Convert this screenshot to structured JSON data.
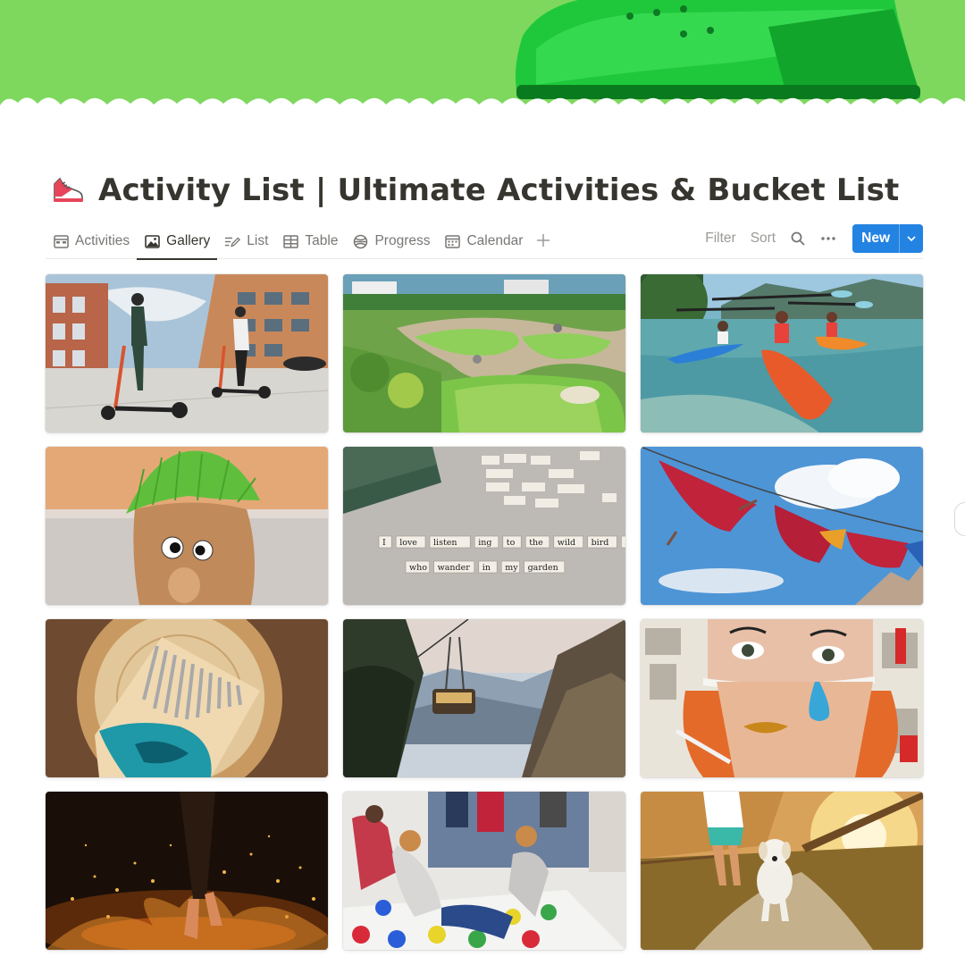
{
  "page": {
    "title": "Activity List | Ultimate Activities & Bucket List",
    "icon": "sneaker-icon"
  },
  "colors": {
    "cover_green": "#7ed85e",
    "accent_blue": "#2383e2",
    "text": "#37352f",
    "muted": "#787774"
  },
  "views": [
    {
      "label": "Activities",
      "icon": "board-icon",
      "active": false
    },
    {
      "label": "Gallery",
      "icon": "image-icon",
      "active": true
    },
    {
      "label": "List",
      "icon": "list-edit-icon",
      "active": false
    },
    {
      "label": "Table",
      "icon": "table-icon",
      "active": false
    },
    {
      "label": "Progress",
      "icon": "progress-icon",
      "active": false
    },
    {
      "label": "Calendar",
      "icon": "calendar-icon",
      "active": false
    }
  ],
  "toolbar": {
    "filter_label": "Filter",
    "sort_label": "Sort",
    "new_label": "New"
  },
  "gallery": {
    "cards": [
      {
        "image": "electric-scooters-city-photo"
      },
      {
        "image": "mini-golf-course-photo"
      },
      {
        "image": "kayaking-lake-photo"
      },
      {
        "image": "grass-head-doll-photo"
      },
      {
        "image": "magnetic-poetry-photo"
      },
      {
        "image": "hammocks-sky-photo"
      },
      {
        "image": "kalimba-instrument-photo"
      },
      {
        "image": "cable-car-mountains-photo"
      },
      {
        "image": "collage-art-photo"
      },
      {
        "image": "fire-walking-sparks-photo"
      },
      {
        "image": "twister-game-photo"
      },
      {
        "image": "walking-dog-sunset-photo"
      }
    ],
    "poetry_words": [
      "I",
      "love",
      "listen",
      "ing",
      "to",
      "the",
      "wild",
      "bird",
      "s",
      "who",
      "wander",
      "in",
      "my",
      "garden"
    ]
  }
}
